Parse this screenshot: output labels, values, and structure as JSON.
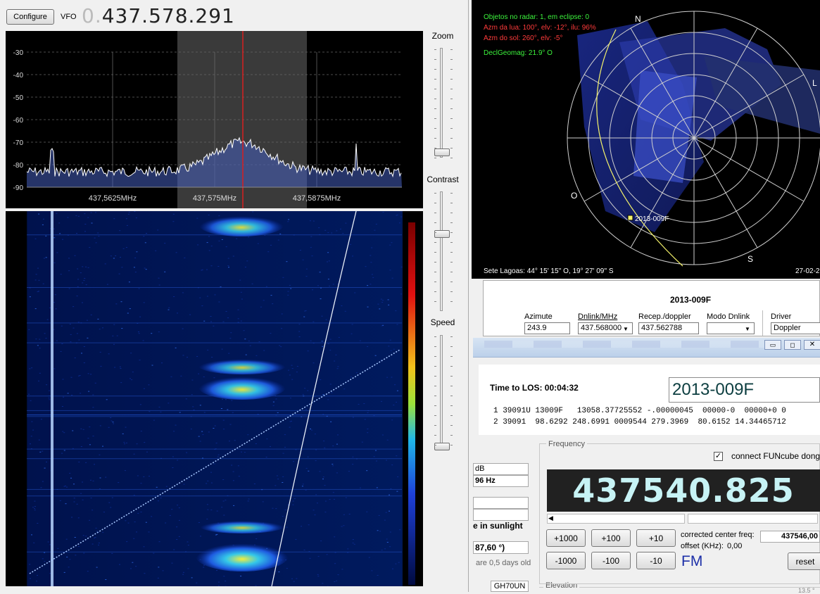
{
  "sdr": {
    "configure_label": "Configure",
    "vfo_label": "VFO",
    "vfo_dim": "0.",
    "vfo_value": "437.578.291",
    "spectrum": {
      "db_labels": [
        "-30",
        "-40",
        "-50",
        "-60",
        "-70",
        "-80",
        "-90"
      ],
      "freq_labels": [
        "437,5625MHz",
        "437,575MHz",
        "437,5875MHz"
      ]
    },
    "sliders": {
      "zoom": "Zoom",
      "contrast": "Contrast",
      "speed": "Speed"
    }
  },
  "radar": {
    "line1": "Objetos no radar: 1, em eclipse: 0",
    "line2": "Azm da lua: 100°, elv: -12°, ilu: 96%",
    "line3": "Azm do sol: 260°, elv: -5°",
    "line4": "DeclGeomag: 21.9° O",
    "dir_n": "N",
    "dir_l": "L",
    "dir_o": "O",
    "dir_s": "S",
    "sat_label": "2013-009F",
    "location": "Sete Lagoas: 44° 15' 15'' O, 19° 27' 09'' S",
    "date": "27-02-2"
  },
  "sat_panel": {
    "title": "2013-009F",
    "azimute_label": "Azimute",
    "azimute_value": "243.9",
    "dnlink_label": "Dnlink/MHz",
    "dnlink_value": "437.568000",
    "recep_label": "Recep./doppler",
    "recep_value": "437.562788",
    "modo_label": "Modo Dnlink",
    "modo_value": "",
    "driver_label": "Driver",
    "driver_value": "Doppler"
  },
  "fcd": {
    "los_label": "Time to LOS: 00:04:32",
    "sat_name": "2013-009F",
    "tle1": "1 39091U 13009F   13058.37725552 -.00000045  00000-0  00000+0 0",
    "tle2": "2 39091  98.6292 248.6991 0009544 279.3969  80.6152 14.34465712",
    "partial_db": "dB",
    "partial_hz": "96 Hz",
    "partial_sunlight": "e in sunlight",
    "partial_deg": "87,60 °)",
    "partial_days": "are 0,5 days old",
    "locator": "GH70UN",
    "elevation_label": "Elevation",
    "elevation_value": "13.5 °",
    "frequency_group": "Frequency",
    "connect_label": "connect FUNcube dongle",
    "connect_checked": "✓",
    "big_freq": "437540.825",
    "plus1000": "+1000",
    "plus100": "+100",
    "plus10": "+10",
    "minus1000": "-1000",
    "minus100": "-100",
    "minus10": "-10",
    "corrected_label": "corrected center freq:",
    "corrected_value": "437546,00",
    "offset_label": "offset (KHz):",
    "offset_value": "0,00",
    "mode": "FM",
    "reset_label": "reset"
  },
  "colors": {
    "spectrum_bg": "#000000",
    "waterfall_bg": "#00114a",
    "center_line": "#d81f1f",
    "passband": "#3a3a3a",
    "radar_text_green": "#3cf23c",
    "radar_text_red": "#ff3b3b",
    "orbit": "#f4f26a",
    "freq_text": "#c7f3f5",
    "mode_text": "#1c2fa8"
  }
}
